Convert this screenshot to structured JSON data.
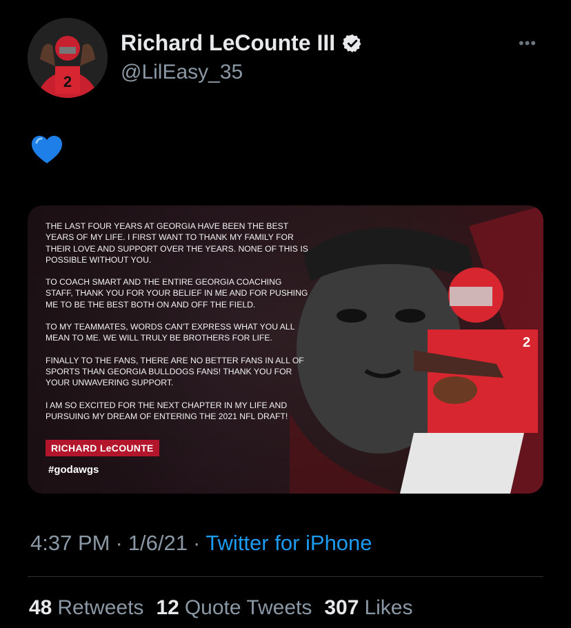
{
  "author": {
    "name": "Richard LeCounte III",
    "handle": "@LilEasy_35",
    "verified": true,
    "avatar": "avatar-player-jersey-2"
  },
  "menu": {
    "icon": "more-icon",
    "label": "•••"
  },
  "tweet": {
    "text_emoji": "💙",
    "image": {
      "paragraphs": [
        "THE LAST FOUR YEARS AT GEORGIA HAVE BEEN THE BEST YEARS OF MY LIFE. I FIRST WANT TO THANK MY FAMILY FOR THEIR LOVE AND SUPPORT OVER THE YEARS. NONE OF THIS IS POSSIBLE WITHOUT YOU.",
        "TO COACH SMART AND THE ENTIRE GEORGIA COACHING STAFF, THANK YOU FOR YOUR BELIEF IN ME AND FOR PUSHING ME TO BE THE BEST BOTH ON AND OFF THE FIELD.",
        "TO MY TEAMMATES, WORDS CAN'T EXPRESS WHAT YOU ALL MEAN TO ME. WE WILL TRULY BE BROTHERS FOR LIFE.",
        "FINALLY TO THE FANS, THERE ARE NO BETTER FANS IN ALL OF SPORTS THAN GEORGIA BULLDOGS FANS! THANK YOU FOR YOUR UNWAVERING SUPPORT.",
        "I AM SO EXCITED FOR THE NEXT CHAPTER IN MY LIFE AND PURSUING MY DREAM OF ENTERING THE 2021 NFL DRAFT!"
      ],
      "signature": "RICHARD LeCOUNTE",
      "hashtag": "#godawgs",
      "player_number": "2",
      "accent": "#b3152b"
    }
  },
  "meta": {
    "time": "4:37 PM",
    "date": "1/6/21",
    "separator": "·",
    "source": "Twitter for iPhone"
  },
  "stats": {
    "retweets_count": "48",
    "retweets_label": "Retweets",
    "quotes_count": "12",
    "quotes_label": "Quote Tweets",
    "likes_count": "307",
    "likes_label": "Likes"
  },
  "colors": {
    "background": "#000000",
    "text": "#e7e9ea",
    "muted": "#8b98a5",
    "link": "#1d9bf0",
    "divider": "#2f3336"
  }
}
